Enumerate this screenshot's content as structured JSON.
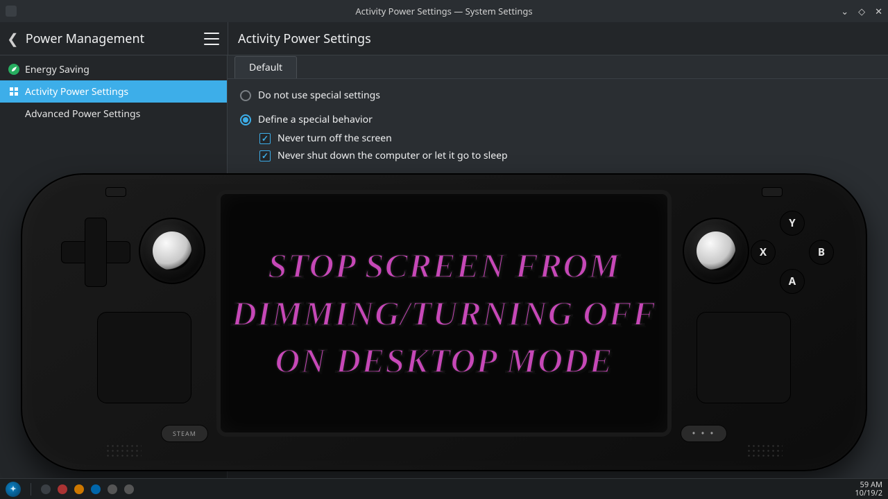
{
  "window": {
    "title": "Activity Power Settings — System Settings"
  },
  "header": {
    "breadcrumb_back": "Power Management",
    "page_title": "Activity Power Settings"
  },
  "sidebar": {
    "items": [
      {
        "label": "Energy Saving"
      },
      {
        "label": "Activity Power Settings"
      },
      {
        "label": "Advanced Power Settings"
      }
    ]
  },
  "content": {
    "tab_default": "Default",
    "radio_do_not_use": "Do not use special settings",
    "radio_define_behavior": "Define a special behavior",
    "check_never_screen": "Never turn off the screen",
    "check_never_shutdown": "Never shut down the computer or let it go to sleep"
  },
  "device": {
    "steam_label": "STEAM",
    "dots_label": "• • •",
    "buttons": {
      "y": "Y",
      "b": "B",
      "a": "A",
      "x": "X"
    }
  },
  "caption": {
    "line1": "Stop Screen From",
    "line2": "Dimming/Turning Off",
    "line3": "On Desktop Mode"
  },
  "taskbar": {
    "time": "59 AM",
    "date": "10/19/2"
  },
  "colors": {
    "accent": "#3daee9",
    "caption": "#c648b7"
  }
}
